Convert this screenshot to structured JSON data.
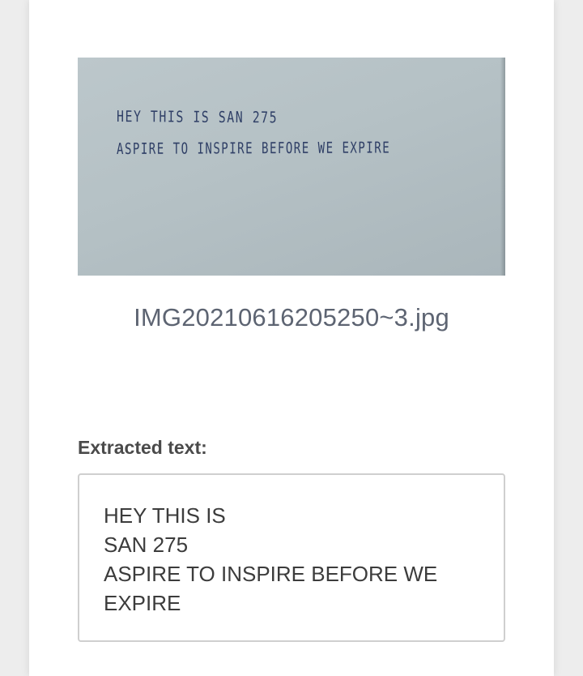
{
  "photo": {
    "handwritten_lines": [
      "HEY THIS IS SAN 275",
      "ASPIRE TO INSPIRE BEFORE WE EXPIRE"
    ]
  },
  "file": {
    "name": "IMG20210616205250~3.jpg"
  },
  "extracted": {
    "label": "Extracted text:",
    "lines": [
      "HEY THIS IS",
      "SAN 275",
      "ASPIRE TO INSPIRE BEFORE WE",
      "EXPIRE"
    ]
  }
}
